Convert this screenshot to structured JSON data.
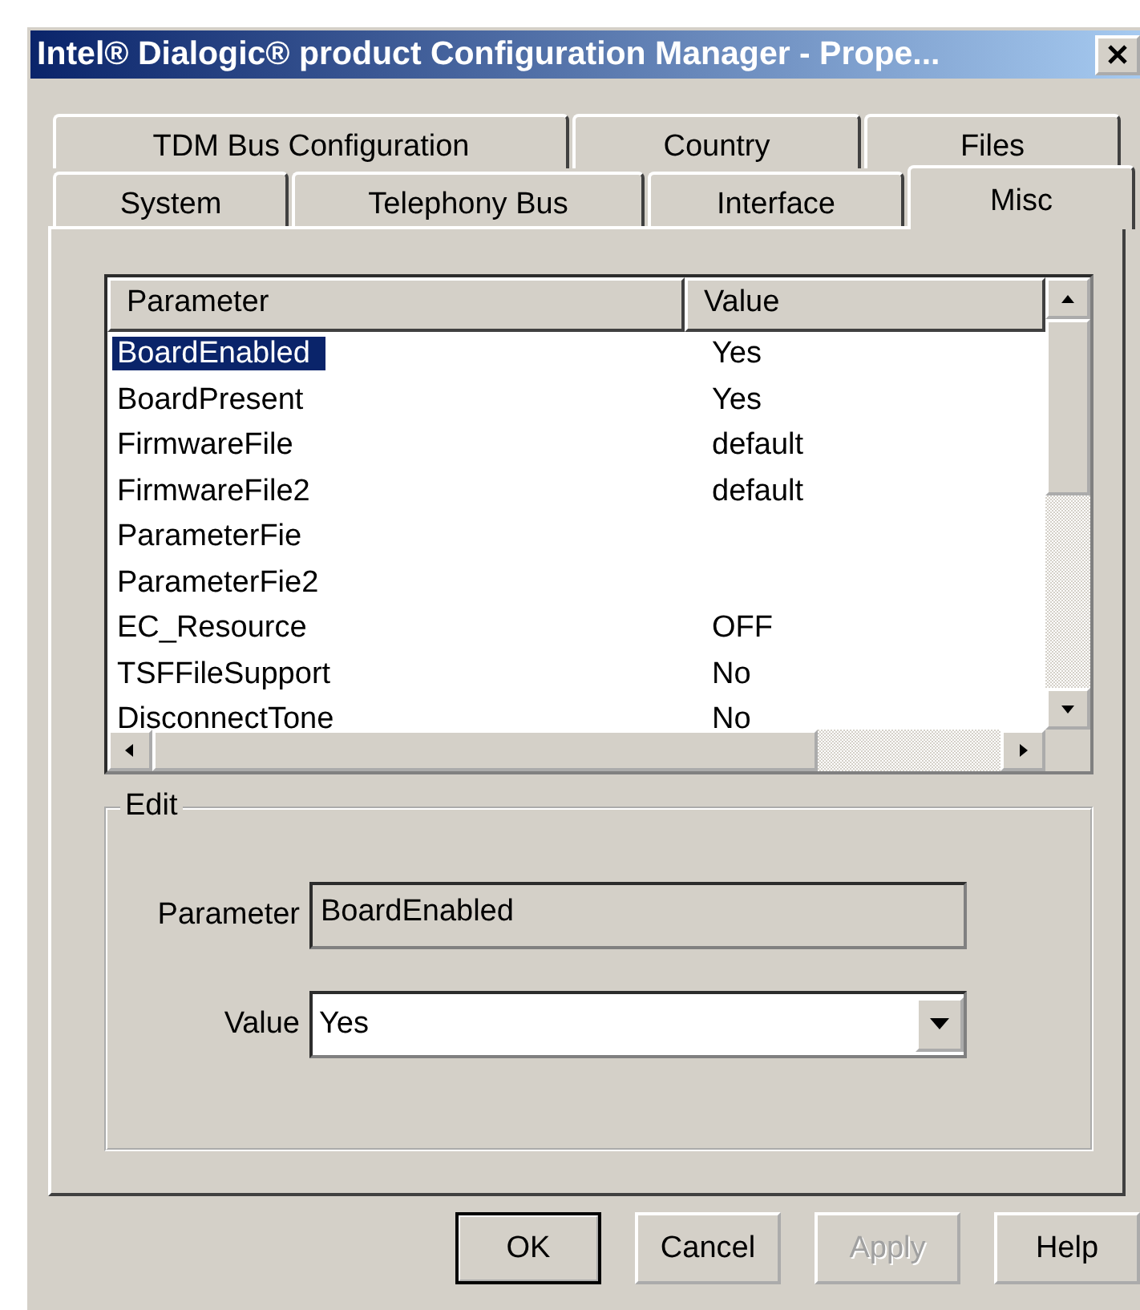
{
  "window": {
    "title": "Intel® Dialogic® product Configuration Manager - Prope..."
  },
  "tab_rows": [
    [
      {
        "label": "TDM Bus Configuration",
        "selected": false
      },
      {
        "label": "Country",
        "selected": false
      },
      {
        "label": "Files",
        "selected": false
      }
    ],
    [
      {
        "label": "System",
        "selected": false
      },
      {
        "label": "Telephony Bus",
        "selected": false
      },
      {
        "label": "Interface",
        "selected": false
      },
      {
        "label": "Misc",
        "selected": true
      }
    ]
  ],
  "parameter_list": {
    "columns": [
      "Parameter",
      "Value"
    ],
    "rows": [
      {
        "parameter": "BoardEnabled",
        "value": "Yes",
        "selected": true
      },
      {
        "parameter": "BoardPresent",
        "value": "Yes",
        "selected": false
      },
      {
        "parameter": "FirmwareFile",
        "value": "default",
        "selected": false
      },
      {
        "parameter": "FirmwareFile2",
        "value": "default",
        "selected": false
      },
      {
        "parameter": "ParameterFie",
        "selected": false
      },
      {
        "parameter": "ParameterFie2",
        "selected": false
      },
      {
        "parameter": "EC_Resource",
        "value": "OFF",
        "selected": false
      },
      {
        "parameter": "TSFFileSupport",
        "value": "No",
        "selected": false
      },
      {
        "parameter": "DisconnectTone",
        "value": "No",
        "selected": false
      }
    ]
  },
  "edit_group": {
    "title": "Edit",
    "parameter_label": "Parameter",
    "parameter_value": "BoardEnabled",
    "value_label": "Value",
    "value": "Yes"
  },
  "buttons": [
    {
      "label": "OK",
      "default": true,
      "disabled": false
    },
    {
      "label": "Cancel",
      "default": false,
      "disabled": false
    },
    {
      "label": "Apply",
      "default": false,
      "disabled": true
    },
    {
      "label": "Help",
      "default": false,
      "disabled": false
    }
  ]
}
